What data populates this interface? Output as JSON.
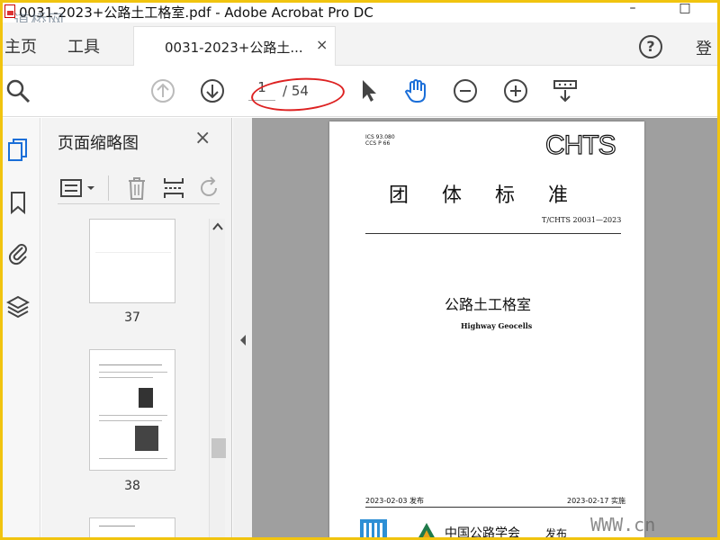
{
  "window": {
    "title": "0031-2023+公路土工格室.pdf - Adobe Acrobat Pro DC",
    "watermark": "道桥网",
    "minimize": "–",
    "maximize": "□"
  },
  "menubar": {
    "home": "主页",
    "tools": "工具",
    "doc_tab": "0031-2023+公路土...",
    "close_tab": "×",
    "help": "?",
    "login": "登"
  },
  "toolbar": {
    "current_page": "1",
    "total_pages": "/ 54"
  },
  "thumbnail_panel": {
    "title": "页面缩略图",
    "close": "×",
    "thumbnails": [
      {
        "label": "37"
      },
      {
        "label": "38"
      }
    ]
  },
  "document": {
    "ics": "ICS 93.080",
    "ccs": "CCS P 66",
    "logo": "CHTS",
    "standard_type": "团 体 标 准",
    "standard_no": "T/CHTS 20031—2023",
    "title_cn": "公路土工格室",
    "title_en": "Highway Geocells",
    "publish_date": "2023-02-03 发布",
    "impl_date": "2023-02-17 实施",
    "org_name": "中国公路学会",
    "publish": "发布",
    "site_watermark": "WWW.cn"
  },
  "colors": {
    "frame_border": "#f1c40f",
    "doc_background": "#9f9f9f",
    "highlight_oval": "#dd2222"
  }
}
